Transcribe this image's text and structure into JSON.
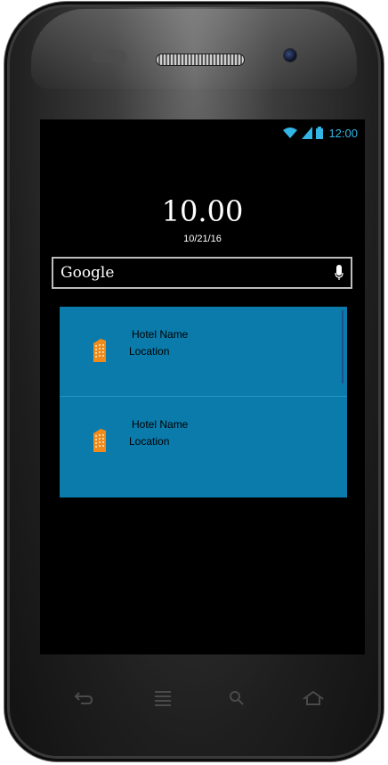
{
  "status_bar": {
    "time": "12:00",
    "wifi_icon": "wifi-icon",
    "signal_icon": "signal-icon",
    "battery_icon": "battery-icon"
  },
  "clock": {
    "time": "10.00",
    "date": "10/21/16"
  },
  "search": {
    "brand": "Google",
    "mic_icon": "microphone-icon"
  },
  "hotels": [
    {
      "name": "Hotel Name",
      "location": "Location",
      "icon": "hotel-building-icon"
    },
    {
      "name": "Hotel Name",
      "location": "Location",
      "icon": "hotel-building-icon"
    }
  ],
  "nav_buttons": [
    "back-icon",
    "menu-icon",
    "search-icon",
    "home-icon"
  ],
  "colors": {
    "accent": "#33b5e5",
    "list_background": "#0a7bab",
    "hotel_icon": "#f08a1c"
  }
}
